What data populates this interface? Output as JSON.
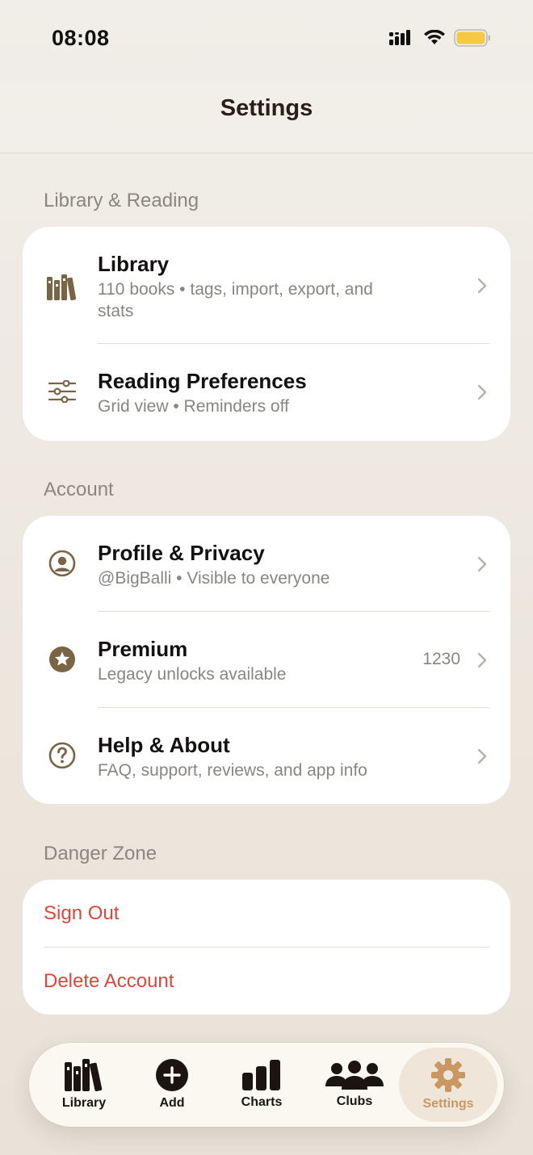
{
  "status_bar": {
    "time": "08:08"
  },
  "header": {
    "title": "Settings"
  },
  "sections": {
    "library_reading": {
      "title": "Library & Reading",
      "library": {
        "title": "Library",
        "subtitle": "110 books • tags, import, export, and stats"
      },
      "reading_prefs": {
        "title": "Reading Preferences",
        "subtitle": "Grid view • Reminders off"
      }
    },
    "account": {
      "title": "Account",
      "profile": {
        "title": "Profile & Privacy",
        "subtitle": "@BigBalli • Visible to everyone"
      },
      "premium": {
        "title": "Premium",
        "subtitle": "Legacy unlocks available",
        "value": "1230"
      },
      "help": {
        "title": "Help & About",
        "subtitle": "FAQ, support, reviews, and app info"
      }
    },
    "danger": {
      "title": "Danger Zone",
      "sign_out": "Sign Out",
      "delete_account": "Delete Account"
    }
  },
  "tabs": [
    {
      "label": "Library",
      "icon": "books-icon"
    },
    {
      "label": "Add",
      "icon": "plus-circle-icon"
    },
    {
      "label": "Charts",
      "icon": "bar-chart-icon"
    },
    {
      "label": "Clubs",
      "icon": "group-icon"
    },
    {
      "label": "Settings",
      "icon": "gear-icon",
      "active": true
    }
  ],
  "colors": {
    "accent": "#c99763",
    "icon_brown": "#7a6446",
    "danger": "#d9483b"
  }
}
